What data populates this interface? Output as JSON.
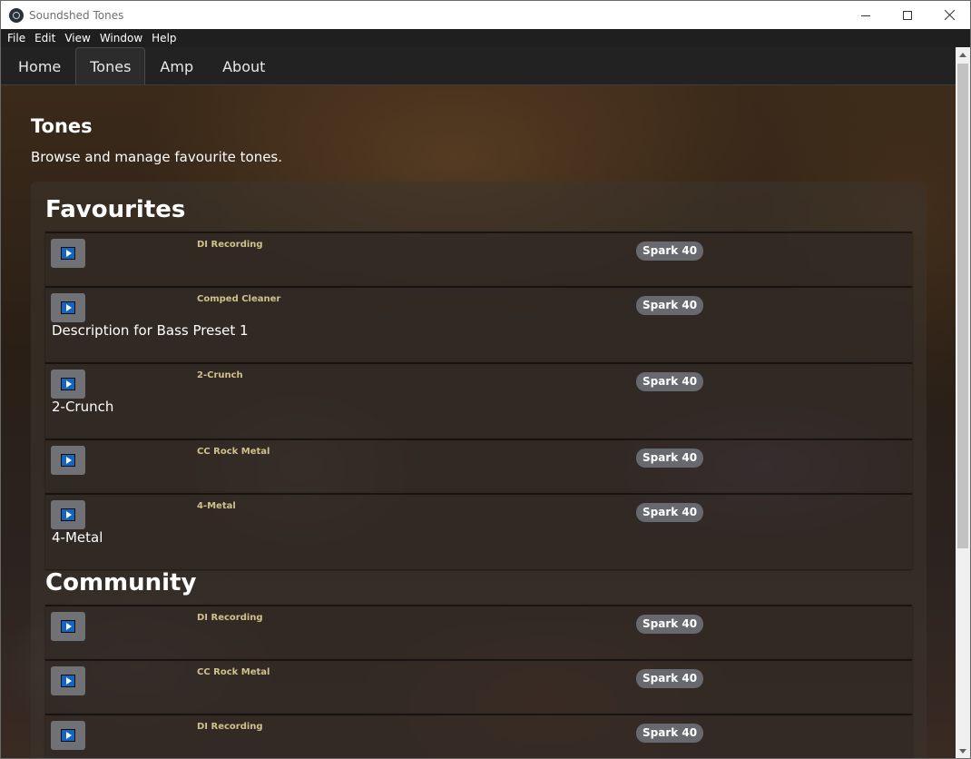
{
  "window": {
    "title": "Soundshed Tones"
  },
  "menu": [
    "File",
    "Edit",
    "View",
    "Window",
    "Help"
  ],
  "tabs": [
    {
      "label": "Home",
      "active": false
    },
    {
      "label": "Tones",
      "active": true
    },
    {
      "label": "Amp",
      "active": false
    },
    {
      "label": "About",
      "active": false
    }
  ],
  "page": {
    "title": "Tones",
    "subtitle": "Browse and manage favourite tones."
  },
  "favourites": {
    "title": "Favourites",
    "items": [
      {
        "name": "DI Recording",
        "device": "Spark 40",
        "description": ""
      },
      {
        "name": "Comped Cleaner",
        "device": "Spark 40",
        "description": "Description for Bass Preset 1"
      },
      {
        "name": "2-Crunch",
        "device": "Spark 40",
        "description": "2-Crunch"
      },
      {
        "name": "CC Rock Metal",
        "device": "Spark 40",
        "description": ""
      },
      {
        "name": "4-Metal",
        "device": "Spark 40",
        "description": "4-Metal"
      }
    ]
  },
  "community": {
    "title": "Community",
    "items": [
      {
        "name": "DI Recording",
        "device": "Spark 40",
        "description": ""
      },
      {
        "name": "CC Rock Metal",
        "device": "Spark 40",
        "description": ""
      },
      {
        "name": "DI Recording",
        "device": "Spark 40",
        "description": ""
      }
    ]
  },
  "colors": {
    "tone_name": "#cfc28a",
    "badge": "#67696e",
    "play_icon": "#1565c0"
  },
  "icons": {
    "app": "soundshed-logo-icon",
    "play": "play-icon",
    "minimize": "minimize-icon",
    "maximize": "maximize-icon",
    "close": "close-icon"
  }
}
